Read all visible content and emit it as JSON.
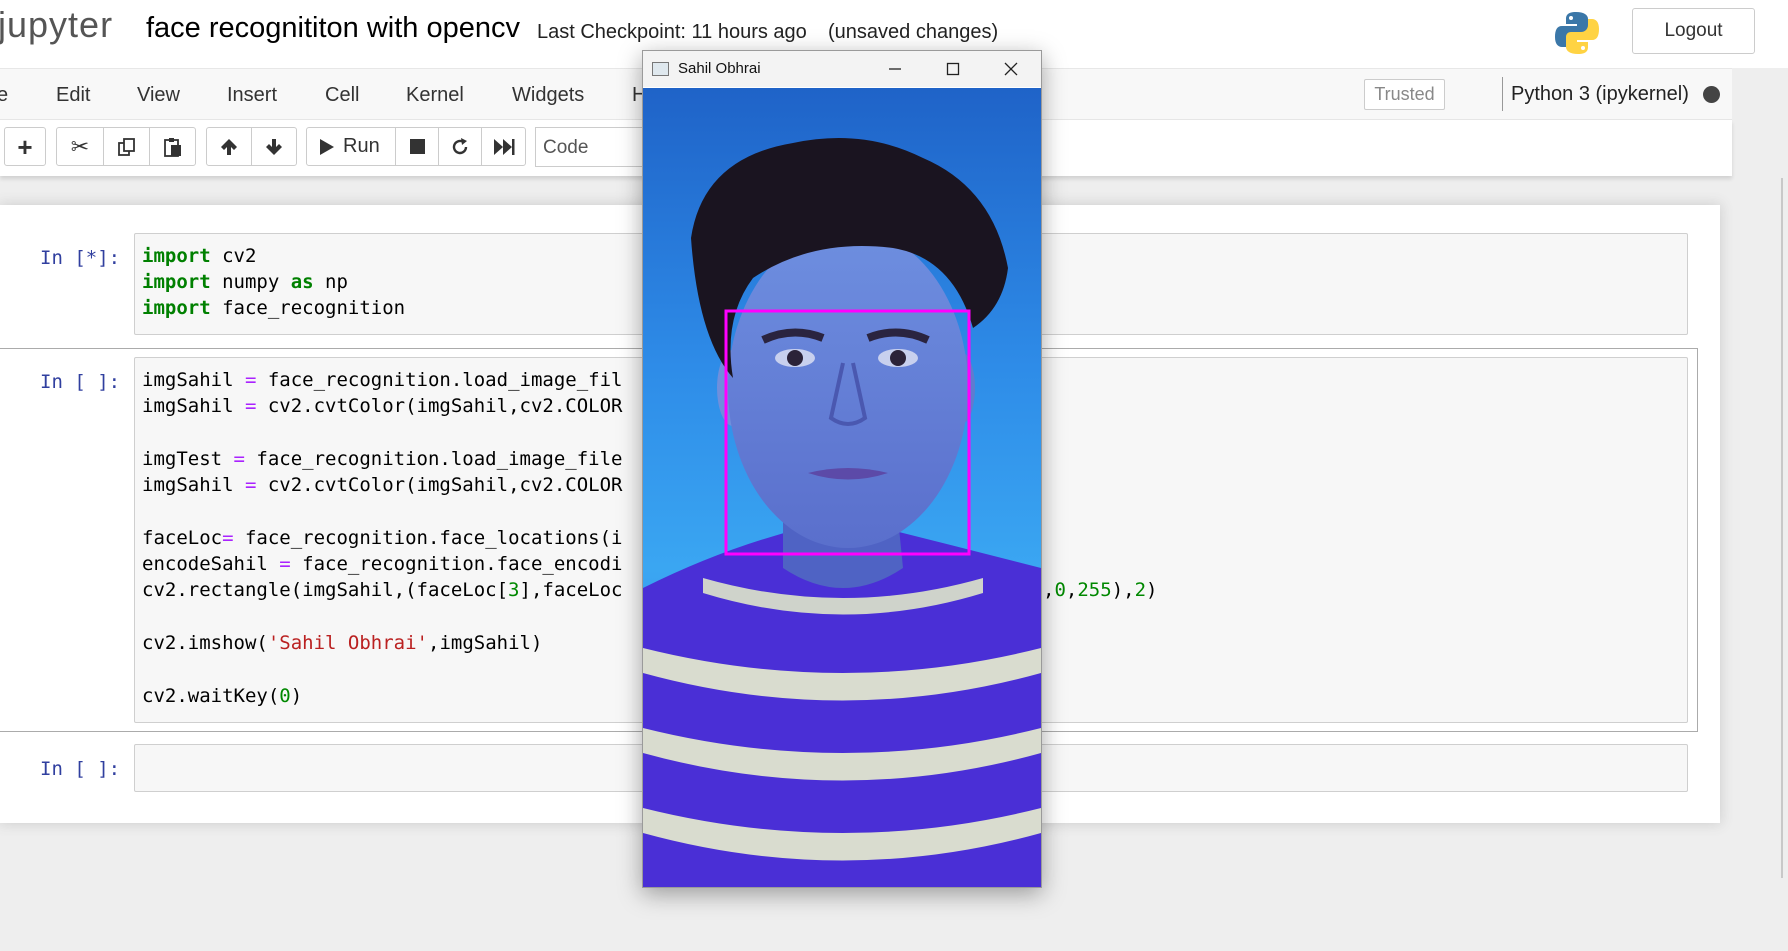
{
  "header": {
    "logo_text": "jupyter",
    "notebook_title": "face recognititon with opencv",
    "checkpoint": "Last Checkpoint: 11 hours ago",
    "unsaved": "(unsaved changes)",
    "logout_label": "Logout",
    "python_logo_icon": "python-logo-icon"
  },
  "menubar": {
    "items": [
      "e",
      "Edit",
      "View",
      "Insert",
      "Cell",
      "Kernel",
      "Widgets",
      "H"
    ],
    "trusted_label": "Trusted",
    "kernel_name": "Python 3 (ipykernel)"
  },
  "toolbar": {
    "run_label": "Run",
    "cell_type": "Code",
    "icons": [
      "plus-icon",
      "cut-icon",
      "copy-icon",
      "paste-icon",
      "arrow-up-icon",
      "arrow-down-icon",
      "play-icon",
      "stop-icon",
      "restart-icon",
      "fast-forward-icon"
    ]
  },
  "cells": [
    {
      "prompt": "In [*]:",
      "lines": [
        "import cv2",
        "import numpy as np",
        "import face_recognition"
      ]
    },
    {
      "prompt": "In [ ]:",
      "lines": [
        "imgSahil = face_recognition.load_image_fil",
        "imgSahil = cv2.cvtColor(imgSahil,cv2.COLOR",
        "",
        "imgTest = face_recognition.load_image_file",
        "imgSahil = cv2.cvtColor(imgSahil,cv2.COLOR",
        "",
        "faceLoc= face_recognition.face_locations(i",
        "encodeSahil = face_recognition.face_encodi",
        "cv2.rectangle(imgSahil,(faceLoc[3],faceLoc",
        "",
        "cv2.imshow('Sahil Obhrai',imgSahil)",
        "",
        "cv2.waitKey(0)"
      ],
      "overflow_text": ",0,255),2)"
    },
    {
      "prompt": "In [ ]:",
      "lines": []
    }
  ],
  "cv_window": {
    "title": "Sahil Obhrai",
    "detection_box_color": "#ff00ff"
  },
  "colors": {
    "keyword": "#008000",
    "operator": "#aa22ff",
    "string": "#ba2121",
    "prompt": "#303f9f"
  }
}
